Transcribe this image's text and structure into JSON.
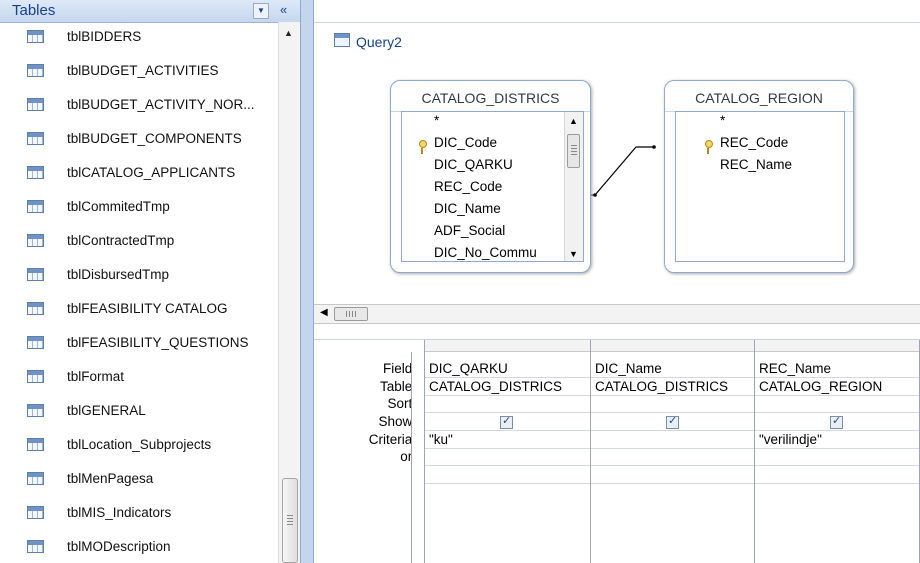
{
  "nav": {
    "title": "Tables",
    "dropdown_glyph": "▼",
    "collapse_glyph": "«",
    "items": [
      {
        "label": "tblBIDDERS"
      },
      {
        "label": "tblBUDGET_ACTIVITIES"
      },
      {
        "label": "tblBUDGET_ACTIVITY_NOR..."
      },
      {
        "label": "tblBUDGET_COMPONENTS"
      },
      {
        "label": "tblCATALOG_APPLICANTS"
      },
      {
        "label": "tblCommitedTmp"
      },
      {
        "label": "tblContractedTmp"
      },
      {
        "label": "tblDisbursedTmp"
      },
      {
        "label": "tblFEASIBILITY CATALOG"
      },
      {
        "label": "tblFEASIBILITY_QUESTIONS"
      },
      {
        "label": "tblFormat"
      },
      {
        "label": "tblGENERAL"
      },
      {
        "label": "tblLocation_Subprojects"
      },
      {
        "label": "tblMenPagesa"
      },
      {
        "label": "tblMIS_Indicators"
      },
      {
        "label": "tblMODescription"
      }
    ]
  },
  "query": {
    "tab_label": "Query2",
    "tables": [
      {
        "name": "CATALOG_DISTRICS",
        "fields": [
          {
            "label": "*",
            "key": false
          },
          {
            "label": "DIC_Code",
            "key": true
          },
          {
            "label": "DIC_QARKU",
            "key": false
          },
          {
            "label": "REC_Code",
            "key": false
          },
          {
            "label": "DIC_Name",
            "key": false
          },
          {
            "label": "ADF_Social",
            "key": false
          },
          {
            "label": "DIC_No_Commu",
            "key": false
          }
        ]
      },
      {
        "name": "CATALOG_REGION",
        "fields": [
          {
            "label": "*",
            "key": false
          },
          {
            "label": "REC_Code",
            "key": true
          },
          {
            "label": "REC_Name",
            "key": false
          }
        ]
      }
    ]
  },
  "grid": {
    "row_labels": {
      "field": "Field:",
      "table": "Table:",
      "sort": "Sort:",
      "show": "Show:",
      "criteria": "Criteria:",
      "or": "or:"
    },
    "columns": [
      {
        "field": "DIC_QARKU",
        "table": "CATALOG_DISTRICS",
        "sort": "",
        "show": true,
        "criteria": "\"ku\"",
        "or": ""
      },
      {
        "field": "DIC_Name",
        "table": "CATALOG_DISTRICS",
        "sort": "",
        "show": true,
        "criteria": "",
        "or": ""
      },
      {
        "field": "REC_Name",
        "table": "CATALOG_REGION",
        "sort": "",
        "show": true,
        "criteria": "\"verilindje\"",
        "or": ""
      }
    ]
  }
}
